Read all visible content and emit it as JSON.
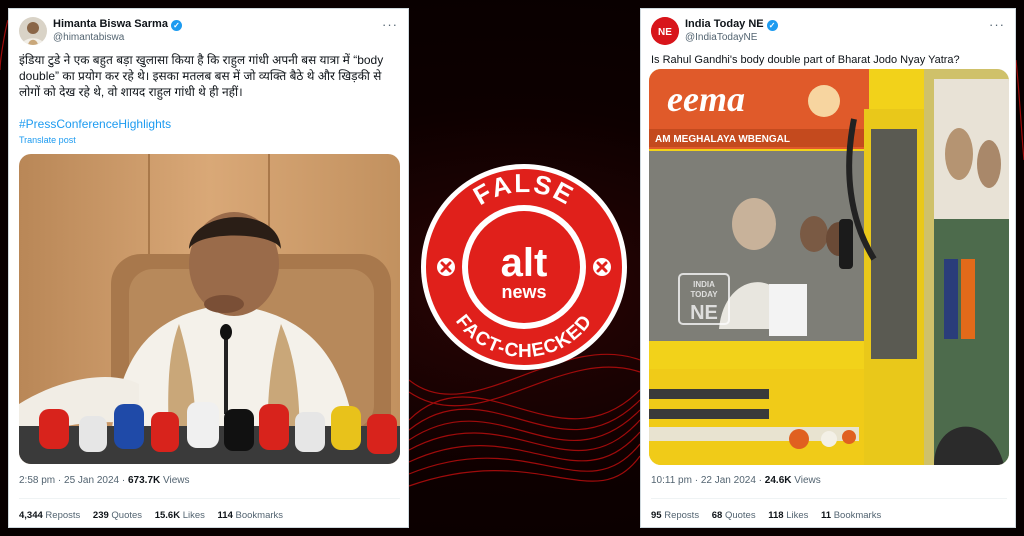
{
  "left_tweet": {
    "author_name": "Himanta Biswa Sarma",
    "handle": "@himantabiswa",
    "text_line1": "इंडिया टुडे ने एक बहुत बड़ा खुलासा किया है कि राहुल गांधी अपनी बस यात्रा में “body",
    "text_line2": "double” का प्रयोग कर रहे थे। इसका मतलब बस में जो व्यक्ति बैठे थे और खिड़की से",
    "text_line3": "लोगों को देख रहे थे, वो शायद राहुल गांधी थे ही नहीं।",
    "hashtag": "#PressConferenceHighlights",
    "translate_label": "Translate post",
    "time": "2:58 pm",
    "date": "25 Jan 2024",
    "views_count": "673.7K",
    "views_label": "Views",
    "reposts_count": "4,344",
    "reposts_label": "Reposts",
    "quotes_count": "239",
    "quotes_label": "Quotes",
    "likes_count": "15.6K",
    "likes_label": "Likes",
    "bookmarks_count": "114",
    "bookmarks_label": "Bookmarks"
  },
  "right_tweet": {
    "author_name": "India Today NE",
    "handle": "@IndiaTodayNE",
    "avatar_text": "NE",
    "text": "Is Rahul Gandhi's body double part of Bharat Jodo Nyay Yatra?",
    "bus_sign_text": "eema",
    "bus_route_text": "AM MEGHALAYA WBENGAL",
    "watermark_line1": "INDIA",
    "watermark_line2": "TODAY",
    "watermark_line3": "NE",
    "time": "10:11 pm",
    "date": "22 Jan 2024",
    "views_count": "24.6K",
    "views_label": "Views",
    "reposts_count": "95",
    "reposts_label": "Reposts",
    "quotes_count": "68",
    "quotes_label": "Quotes",
    "likes_count": "118",
    "likes_label": "Likes",
    "bookmarks_count": "11",
    "bookmarks_label": "Bookmarks"
  },
  "stamp": {
    "top_word": "FALSE",
    "logo_top": "alt",
    "logo_bottom": "news",
    "bottom_text": "FACT-CHECKED",
    "color": "#e0201b"
  },
  "icons": {
    "verified": "verified-badge-icon",
    "more": "more-options-icon"
  },
  "colors": {
    "verified": "#1d9bf0",
    "link": "#1d9bf0",
    "stamp_red": "#e0201b",
    "bus_yellow": "#f2d21a"
  }
}
